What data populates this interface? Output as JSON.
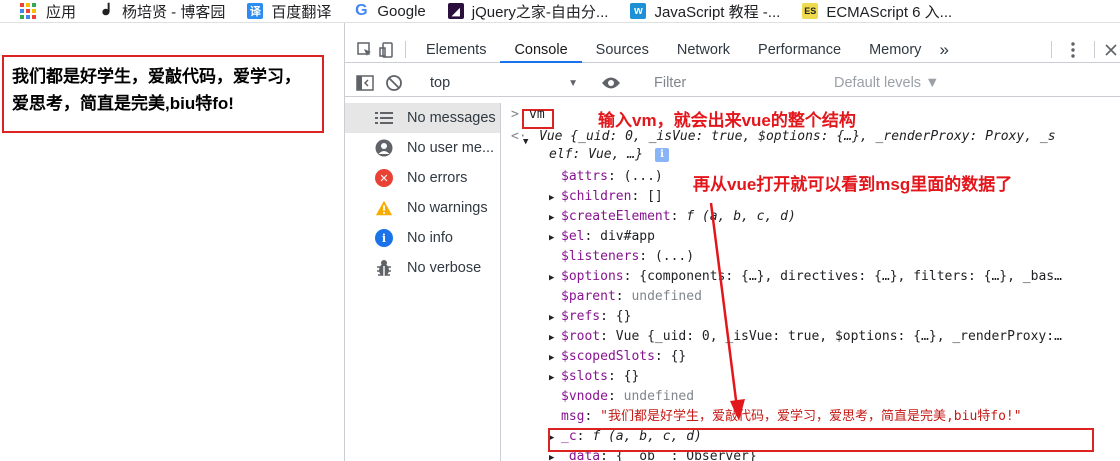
{
  "bookmarks": [
    {
      "label": "应用",
      "icon": "apps-grid-icon"
    },
    {
      "label": "杨培贤 - 博客园",
      "icon": "cnblogs-icon"
    },
    {
      "label": "百度翻译",
      "icon": "baidu-translate-icon"
    },
    {
      "label": "Google",
      "icon": "google-icon"
    },
    {
      "label": "jQuery之家-自由分...",
      "icon": "jquery-icon"
    },
    {
      "label": "JavaScript 教程 -...",
      "icon": "w3-icon"
    },
    {
      "label": "ECMAScript 6 入...",
      "icon": "es-icon"
    }
  ],
  "page": {
    "text": "我们都是好学生，爱敲代码，爱学习，爱思考，简直是完美,biu特fo!"
  },
  "devtools": {
    "tabs": [
      "Elements",
      "Console",
      "Sources",
      "Network",
      "Performance",
      "Memory"
    ],
    "active_tab": "Console",
    "more_tabs": "»",
    "context": "top",
    "filter_placeholder": "Filter",
    "levels": "Default levels ▼"
  },
  "sidebar": {
    "items": [
      {
        "label": "No messages",
        "icon": "list-icon"
      },
      {
        "label": "No user me...",
        "icon": "user-icon"
      },
      {
        "label": "No errors",
        "icon": "error-icon"
      },
      {
        "label": "No warnings",
        "icon": "warning-icon"
      },
      {
        "label": "No info",
        "icon": "info-icon"
      },
      {
        "label": "No verbose",
        "icon": "bug-icon"
      }
    ]
  },
  "console": {
    "input": "vm",
    "vue_line1": "Vue {_uid: 0, _isVue: true, $options: {…}, _renderProxy: Proxy, _s",
    "vue_line2": "elf: Vue, …}",
    "props": [
      {
        "key": "$attrs",
        "value": "(...)",
        "expandable": false
      },
      {
        "key": "$children",
        "value": "[]",
        "expandable": true
      },
      {
        "key": "$createElement",
        "value": "f (a, b, c, d)",
        "expandable": true
      },
      {
        "key": "$el",
        "value": "div#app",
        "expandable": true
      },
      {
        "key": "$listeners",
        "value": "(...)",
        "expandable": false
      },
      {
        "key": "$options",
        "value": "{components: {…}, directives: {…}, filters: {…}, _bas…",
        "expandable": true
      },
      {
        "key": "$parent",
        "value": "undefined",
        "expandable": false
      },
      {
        "key": "$refs",
        "value": "{}",
        "expandable": true
      },
      {
        "key": "$root",
        "value": "Vue {_uid: 0, _isVue: true, $options: {…}, _renderProxy:…",
        "expandable": true
      },
      {
        "key": "$scopedSlots",
        "value": "{}",
        "expandable": true
      },
      {
        "key": "$slots",
        "value": "{}",
        "expandable": true
      },
      {
        "key": "$vnode",
        "value": "undefined",
        "expandable": false
      },
      {
        "key": "msg",
        "value": "\"我们都是好学生，爱敲代码，爱学习，爱思考，简直是完美,biu特fo!\"",
        "expandable": false
      },
      {
        "key": "_c",
        "value": "f (a, b, c, d)",
        "expandable": true
      },
      {
        "key": "_data",
        "value": "{__ob__: Observer}",
        "expandable": true
      }
    ]
  },
  "annotations": {
    "note1": "输入vm，就会出来vue的整个结构",
    "note2": "再从vue打开就可以看到msg里面的数据了"
  },
  "colors": {
    "annotation_red": "#e3161b",
    "active_tab_underline": "#1a73e8"
  }
}
